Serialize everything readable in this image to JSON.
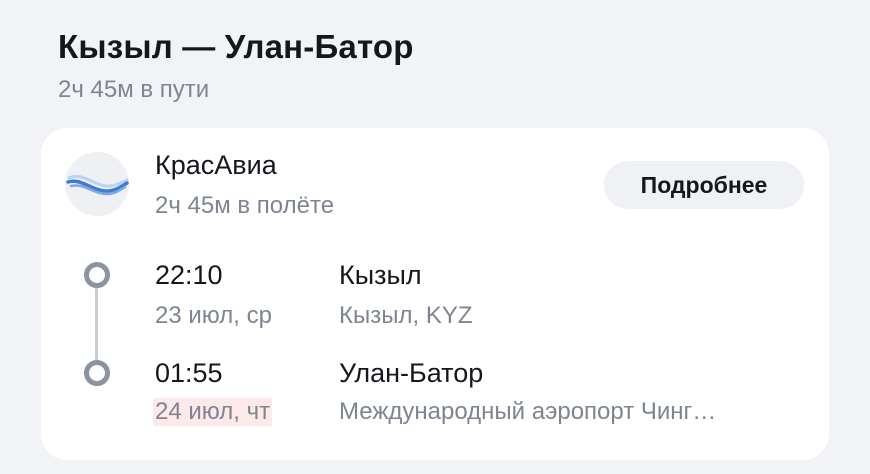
{
  "header": {
    "title": "Кызыл — Улан-Батор",
    "subtitle": "2ч 45м в пути"
  },
  "flight": {
    "airline": "КрасАвиа",
    "airline_logo": "krasavia-wave-logo",
    "duration": "2ч 45м в полёте",
    "details_button": "Подробнее",
    "departure": {
      "time": "22:10",
      "date": "23 июл, ср",
      "city": "Кызыл",
      "airport": "Кызыл, KYZ"
    },
    "arrival": {
      "time": "01:55",
      "date": "24 июл, чт",
      "date_highlighted": true,
      "city": "Улан-Батор",
      "airport": "Международный аэропорт Чинг…"
    }
  },
  "colors": {
    "background": "#f2f3f7",
    "card": "#ffffff",
    "text_primary": "#15171c",
    "text_secondary": "#7e8590",
    "button_bg": "#eff1f4",
    "timeline": "#8b92a0",
    "date_highlight": "#fde8ea",
    "logo_wave": "#3f7bd1"
  }
}
